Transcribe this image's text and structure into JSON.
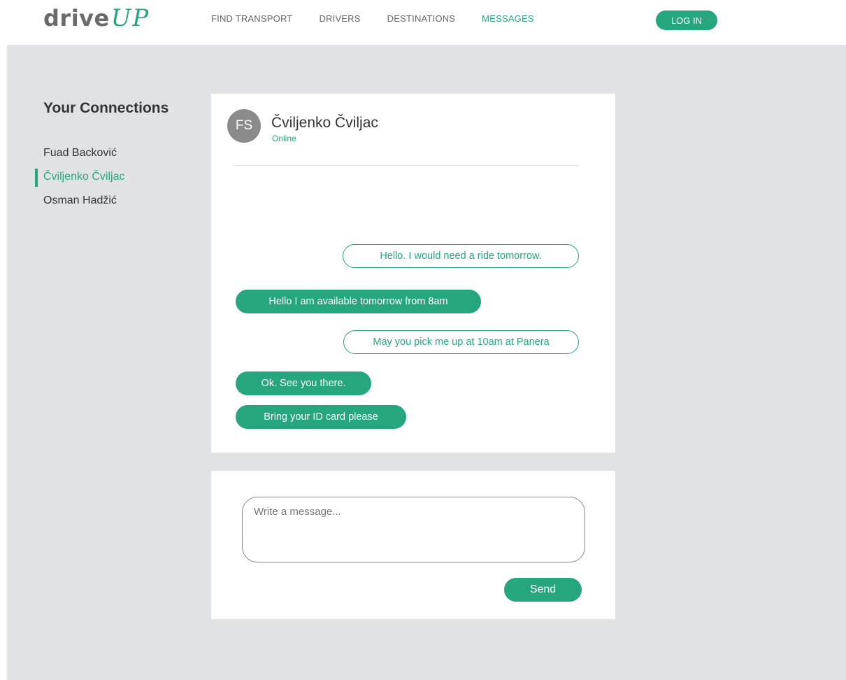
{
  "brand": {
    "name": "drive",
    "accent": "UP",
    "color": "#26a67e"
  },
  "nav": {
    "items": [
      {
        "label": "FIND TRANSPORT",
        "active": false
      },
      {
        "label": "DRIVERS",
        "active": false
      },
      {
        "label": "DESTINATIONS",
        "active": false
      },
      {
        "label": "MESSAGES",
        "active": true
      }
    ],
    "login_label": "LOG IN"
  },
  "connections": {
    "title": "Your Connections",
    "items": [
      {
        "name": "Fuad Backović",
        "active": false
      },
      {
        "name": "Čviljenko Čviljac",
        "active": true
      },
      {
        "name": "Osman Hadžić",
        "active": false
      }
    ]
  },
  "chat": {
    "avatar_initials": "FS",
    "contact_name": "Čviljenko Čviljac",
    "status": "Online",
    "messages": [
      {
        "text": "Hello. I would need a ride tomorrow.",
        "direction": "outgoing"
      },
      {
        "text": "Hello I am available tomorrow from 8am",
        "direction": "incoming"
      },
      {
        "text": "May you pick me up at 10am at Panera",
        "direction": "outgoing"
      },
      {
        "text": "Ok. See you there.",
        "direction": "incoming"
      },
      {
        "text": "Bring your ID card please",
        "direction": "incoming"
      }
    ]
  },
  "compose": {
    "placeholder": "Write a message...",
    "value": "",
    "send_label": "Send"
  }
}
